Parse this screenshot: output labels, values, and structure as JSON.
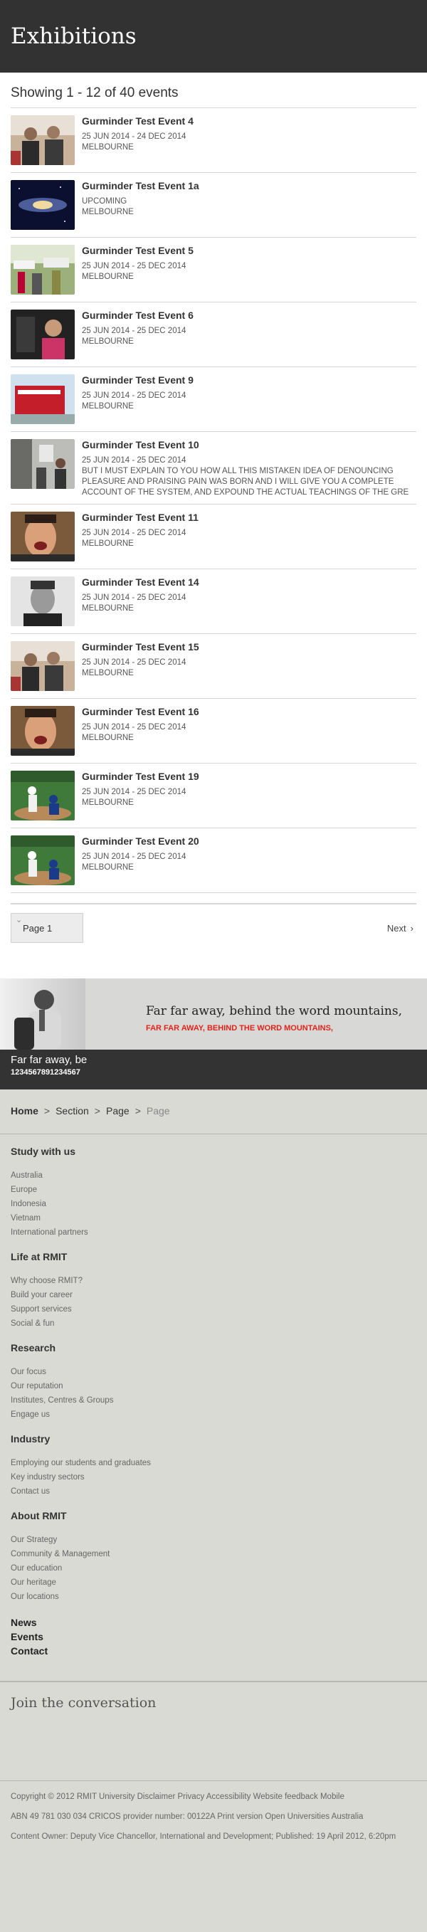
{
  "header": {
    "title": "Exhibitions"
  },
  "listing": {
    "summary": "Showing 1 - 12 of 40 events"
  },
  "events": [
    {
      "title": "Gurminder Test Event 4",
      "lines": [
        "25 JUN 2014 - 24 DEC 2014",
        "MELBOURNE"
      ],
      "desc": "",
      "thumb": "people"
    },
    {
      "title": "Gurminder Test Event 1a",
      "lines": [
        "UPCOMING",
        "MELBOURNE"
      ],
      "desc": "",
      "thumb": "galaxy"
    },
    {
      "title": "Gurminder Test Event 5",
      "lines": [
        "25 JUN 2014 - 25 DEC 2014",
        "MELBOURNE"
      ],
      "desc": "",
      "thumb": "market"
    },
    {
      "title": "Gurminder Test Event 6",
      "lines": [
        "25 JUN 2014 - 25 DEC 2014",
        "MELBOURNE"
      ],
      "desc": "",
      "thumb": "dark"
    },
    {
      "title": "Gurminder Test Event 9",
      "lines": [
        "25 JUN 2014 - 25 DEC 2014",
        "MELBOURNE"
      ],
      "desc": "",
      "thumb": "building"
    },
    {
      "title": "Gurminder Test Event 10",
      "lines": [
        "25 JUN 2014 - 25 DEC 2014"
      ],
      "desc": "BUT I MUST EXPLAIN TO YOU HOW ALL THIS MISTAKEN IDEA OF DENOUNCING PLEASURE AND PRAISING PAIN WAS BORN AND I WILL GIVE YOU A COMPLETE ACCOUNT OF THE SYSTEM, AND EXPOUND THE ACTUAL TEACHINGS OF THE GRE",
      "thumb": "gallery"
    },
    {
      "title": "Gurminder Test Event 11",
      "lines": [
        "25 JUN 2014 - 25 DEC 2014",
        "MELBOURNE"
      ],
      "desc": "",
      "thumb": "face"
    },
    {
      "title": "Gurminder Test Event 14",
      "lines": [
        "25 JUN 2014 - 25 DEC 2014",
        "MELBOURNE"
      ],
      "desc": "",
      "thumb": "bw"
    },
    {
      "title": "Gurminder Test Event 15",
      "lines": [
        "25 JUN 2014 - 25 DEC 2014",
        "MELBOURNE"
      ],
      "desc": "",
      "thumb": "people"
    },
    {
      "title": "Gurminder Test Event 16",
      "lines": [
        "25 JUN 2014 - 25 DEC 2014",
        "MELBOURNE"
      ],
      "desc": "",
      "thumb": "face"
    },
    {
      "title": "Gurminder Test Event 19",
      "lines": [
        "25 JUN 2014 - 25 DEC 2014",
        "MELBOURNE"
      ],
      "desc": "",
      "thumb": "baseball"
    },
    {
      "title": "Gurminder Test Event 20",
      "lines": [
        "25 JUN 2014 - 25 DEC 2014",
        "MELBOURNE"
      ],
      "desc": "",
      "thumb": "baseball"
    }
  ],
  "pager": {
    "page_label": "Page 1",
    "next_label": "Next"
  },
  "banner": {
    "headline": "Far far away, behind the word mountains,",
    "subline": "FAR FAR AWAY, BEHIND THE WORD MOUNTAINS,",
    "bar_line1": "Far far away, be",
    "bar_line2": "1234567891234567"
  },
  "breadcrumb": {
    "home": "Home",
    "section": "Section",
    "page": "Page",
    "current": "Page"
  },
  "footer_nav": [
    {
      "title": "Study with us",
      "items": [
        "Australia",
        "Europe",
        "Indonesia",
        "Vietnam",
        "International partners"
      ]
    },
    {
      "title": "Life at RMIT",
      "items": [
        "Why choose RMIT?",
        "Build your career",
        "Support services",
        "Social & fun"
      ]
    },
    {
      "title": "Research",
      "items": [
        "Our focus",
        "Our reputation",
        "Institutes, Centres & Groups",
        "Engage us"
      ]
    },
    {
      "title": "Industry",
      "items": [
        "Employing our students and graduates",
        "Key industry sectors",
        "Contact us"
      ]
    },
    {
      "title": "About RMIT",
      "items": [
        "Our Strategy",
        "Community & Management",
        "Our education",
        "Our heritage",
        "Our locations"
      ]
    }
  ],
  "footer_links": [
    "News",
    "Events",
    "Contact"
  ],
  "join": {
    "title": "Join the conversation"
  },
  "legal": {
    "copyright": "Copyright © 2012 RMIT University Disclaimer Privacy Accessibility Website feedback Mobile",
    "abn": "ABN 49 781 030 034 CRICOS provider number: 00122A Print version Open Universities Australia",
    "owner": "Content Owner: Deputy Vice Chancellor, International and Development; Published: 19 April 2012, 6:20pm"
  }
}
